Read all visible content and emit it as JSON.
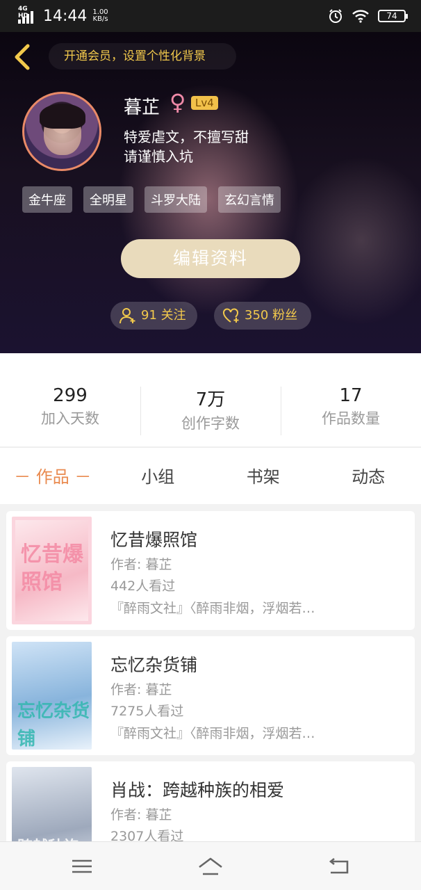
{
  "status_bar": {
    "network": "4G HD",
    "time": "14:44",
    "speed": "1.00",
    "speed_unit": "KB/s",
    "battery": "74"
  },
  "header": {
    "vip_text": "开通会员，设置个性化背景",
    "name": "暮芷",
    "gender_symbol": "♀",
    "level": "Lv4",
    "bio_line1": "特爱虐文，不擅写甜",
    "bio_line2": "请谨慎入坑",
    "tags": [
      "金牛座",
      "全明星",
      "斗罗大陆",
      "玄幻言情"
    ],
    "edit_button": "编辑资料",
    "follow_label": "91 关注",
    "fans_label": "350 粉丝"
  },
  "stats": [
    {
      "value": "299",
      "label": "加入天数"
    },
    {
      "value": "7万",
      "label": "创作字数"
    },
    {
      "value": "17",
      "label": "作品数量"
    }
  ],
  "tabs": [
    "－ 作品 －",
    "小组",
    "书架",
    "动态"
  ],
  "works": [
    {
      "title": "忆昔爆照馆",
      "author": "作者: 暮芷",
      "views": "442人看过",
      "desc": "『醉雨文社』〈醉雨非烟，浮烟若…",
      "cover_text": "忆昔爆照馆"
    },
    {
      "title": "忘忆杂货铺",
      "author": "作者: 暮芷",
      "views": "7275人看过",
      "desc": "『醉雨文社』〈醉雨非烟，浮烟若…",
      "cover_text": "忘忆杂货铺"
    },
    {
      "title": "肖战：跨越种族的相爱",
      "author": "作者: 暮芷",
      "views": "2307人看过",
      "desc": "",
      "cover_text": "跨越种族"
    }
  ],
  "colors": {
    "accent": "#e98a4f",
    "gold": "#f2c94c",
    "level_badge": "#f2c14a",
    "edit_button": "#e9dbbc"
  }
}
